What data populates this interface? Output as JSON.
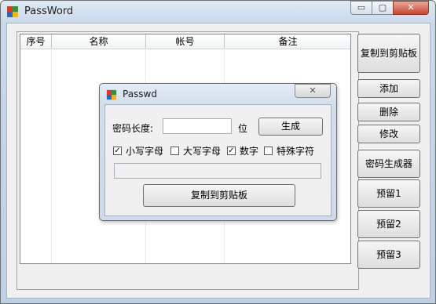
{
  "window": {
    "title": "PassWord"
  },
  "title_controls": {
    "minimize": "▭",
    "maximize": "▢",
    "close": "✕"
  },
  "list": {
    "columns": [
      "序号",
      "名称",
      "帐号",
      "备注"
    ]
  },
  "right_buttons": {
    "copy": "复制到剪贴板",
    "add": "添加",
    "delete": "删除",
    "modify": "修改",
    "generator": "密码生成器",
    "reserve1": "预留1",
    "reserve2": "预留2",
    "reserve3": "预留3"
  },
  "dialog": {
    "title": "Passwd",
    "close": "✕",
    "length_label": "密码长度:",
    "length_value": "",
    "unit_label": "位",
    "generate_button": "生成",
    "options": [
      {
        "label": "小写字母",
        "checked": true
      },
      {
        "label": "大写字母",
        "checked": false
      },
      {
        "label": "数字",
        "checked": true
      },
      {
        "label": "特殊字符",
        "checked": false
      }
    ],
    "result_value": "",
    "copy_button": "复制到剪贴板"
  }
}
